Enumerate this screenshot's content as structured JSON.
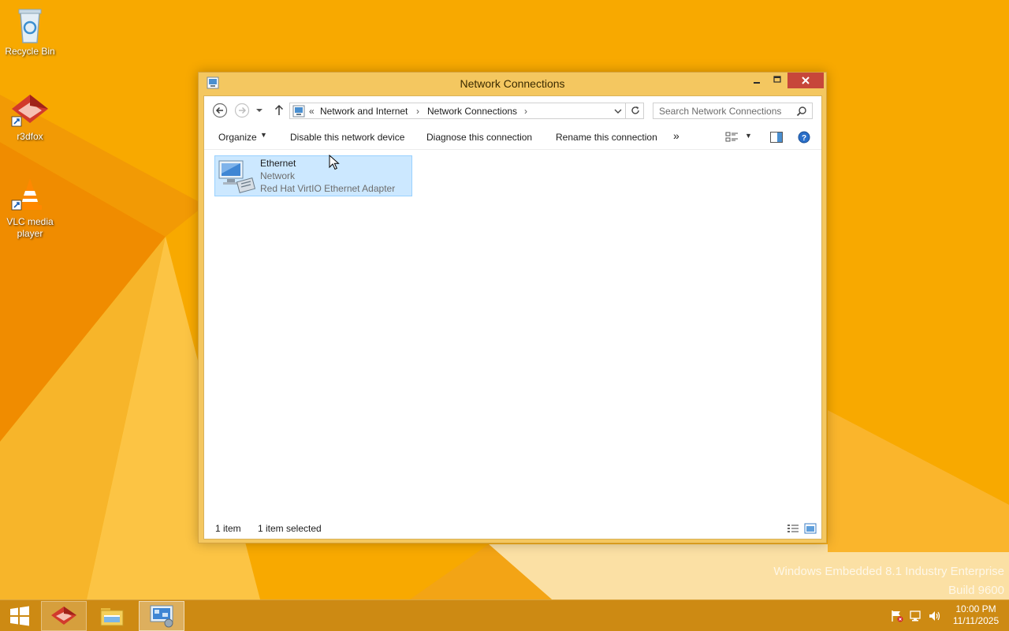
{
  "desktop": {
    "icons": [
      {
        "label": "Recycle Bin"
      },
      {
        "label": "r3dfox"
      },
      {
        "label": "VLC media player"
      }
    ],
    "watermark": {
      "line1": "Windows Embedded 8.1 Industry Enterprise",
      "line2": "Build 9600"
    }
  },
  "window": {
    "title": "Network Connections",
    "address": {
      "overflow": "«",
      "crumbs": [
        "Network and Internet",
        "Network Connections"
      ],
      "separator": "›"
    },
    "search": {
      "placeholder": "Search Network Connections"
    },
    "commands": {
      "organize": "Organize",
      "disable": "Disable this network device",
      "diagnose": "Diagnose this connection",
      "rename": "Rename this connection",
      "more": "»"
    },
    "items": [
      {
        "name": "Ethernet",
        "status": "Network",
        "adapter": "Red Hat VirtIO Ethernet Adapter",
        "selected": true
      }
    ],
    "status_bar": {
      "count": "1 item",
      "selected": "1 item selected"
    }
  },
  "taskbar": {
    "pinned": [
      "r3dfox",
      "File Explorer",
      "Network Connections"
    ],
    "clock": {
      "time": "10:00 PM",
      "date": "11/11/2025"
    }
  },
  "colors": {
    "wallpaper": "#f7a800",
    "window_frame": "#f4c760",
    "close_button": "#c7463a",
    "selection_fill": "#cce8ff",
    "selection_border": "#99d1ff",
    "taskbar": "#c98815"
  }
}
